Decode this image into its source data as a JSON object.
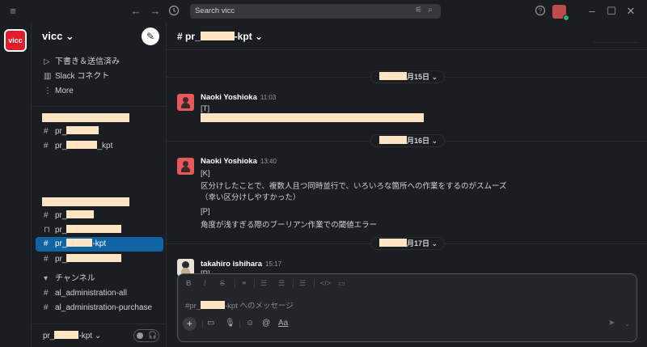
{
  "topbar": {
    "search_placeholder": "Search vicc"
  },
  "workspace": {
    "rail_label": "vicc",
    "name": "vicc ⌄"
  },
  "sidebar": {
    "top_items": [
      {
        "icon": "send-icon",
        "label": "下書き＆送信済み"
      },
      {
        "icon": "building-icon",
        "label": "Slack コネクト"
      },
      {
        "icon": "more-icon",
        "label": "More"
      }
    ],
    "group1": [
      {
        "prefix": "pr_",
        "suffix": ""
      },
      {
        "prefix": "pr_",
        "suffix": "_kpt"
      }
    ],
    "group2": [
      {
        "prefix": "pr_",
        "suffix": "",
        "icon": "hash"
      },
      {
        "prefix": "pr_",
        "suffix": "",
        "icon": "lock"
      },
      {
        "prefix": "pr_",
        "suffix": "-kpt",
        "icon": "hash",
        "active": true
      },
      {
        "prefix": "pr_",
        "suffix": "",
        "icon": "hash"
      }
    ],
    "channels_header": "チャンネル",
    "channels": [
      "al_administration-all",
      "al_administration-purchase"
    ],
    "bottom_name_prefix": "pr_",
    "bottom_name_suffix": "-kpt ⌄"
  },
  "channel": {
    "prefix": "# pr_",
    "suffix": "-kpt ⌄"
  },
  "days": [
    {
      "label": "月15日 ⌄"
    },
    {
      "label": "月16日 ⌄"
    },
    {
      "label": "月17日 ⌄"
    }
  ],
  "messages": [
    {
      "author": "Naoki Yoshioka",
      "time": "11:03",
      "lines": [
        "[T]"
      ]
    },
    {
      "author": "Naoki Yoshioka",
      "time": "13:40",
      "lines": [
        "[K]",
        "区分けしたことで、複数人且つ同時並行で、いろいろな箇所への作業をするのがスムーズ",
        "（幸い区分けしやすかった）",
        "[P]",
        "角度が浅すぎる際のブーリアン作業での閾値エラー"
      ]
    },
    {
      "author": "takahiro ishihara",
      "time": "15:17",
      "lines": [
        "[P]"
      ]
    }
  ],
  "composer": {
    "placeholder_prefix": "#pr_",
    "placeholder_suffix": "-kpt へのメッセージ",
    "format_label": "Aa"
  }
}
